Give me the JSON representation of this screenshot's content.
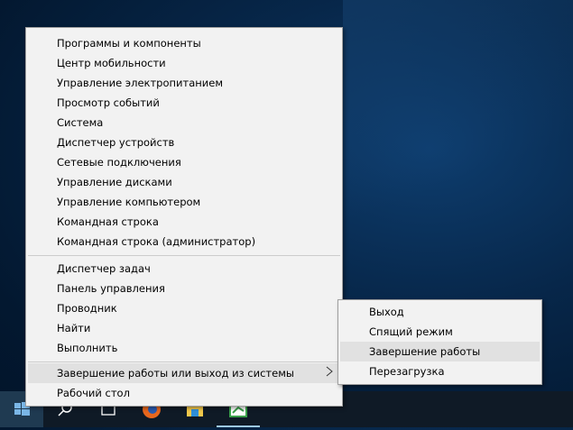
{
  "menu": {
    "items": [
      "Программы и компоненты",
      "Центр мобильности",
      "Управление электропитанием",
      "Просмотр событий",
      "Система",
      "Диспетчер устройств",
      "Сетевые подключения",
      "Управление дисками",
      "Управление компьютером",
      "Командная строка",
      "Командная строка (администратор)"
    ],
    "items2": [
      "Диспетчер задач",
      "Панель управления",
      "Проводник",
      "Найти",
      "Выполнить"
    ],
    "shutdown": "Завершение работы или выход из системы",
    "desktop": "Рабочий стол"
  },
  "submenu": {
    "items": [
      "Выход",
      "Спящий режим",
      "Завершение работы",
      "Перезагрузка"
    ]
  },
  "taskbar": {
    "icons": [
      "windows-start-icon",
      "search-icon",
      "task-view-icon",
      "firefox-icon",
      "file-explorer-icon",
      "app-icon"
    ]
  }
}
